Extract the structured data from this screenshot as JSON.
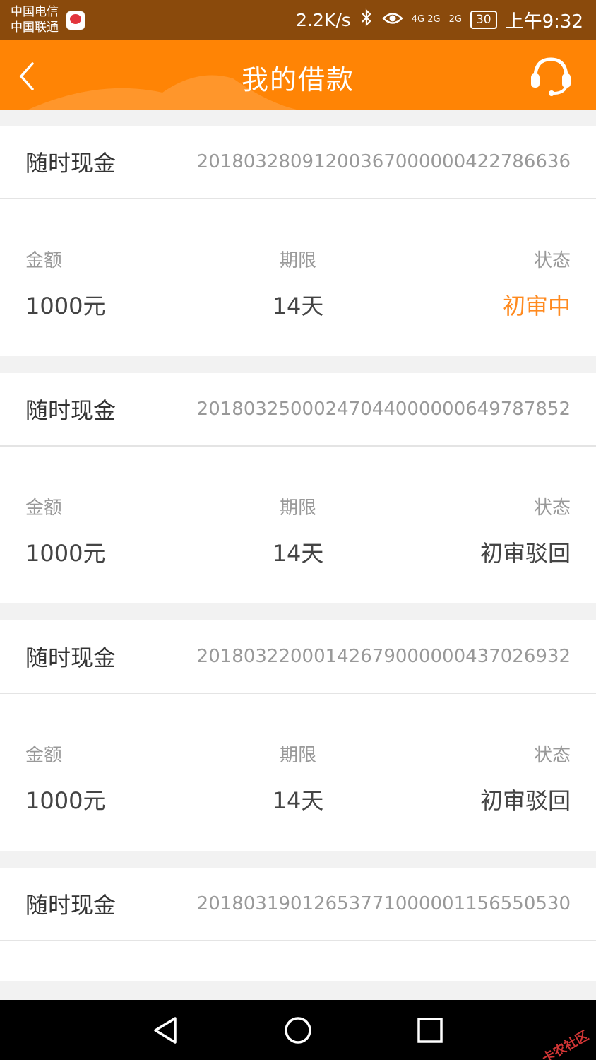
{
  "status_bar": {
    "carrier_1": "中国电信",
    "carrier_2": "中国联通",
    "net_speed": "2.2K/s",
    "signal_1": "4G 2G",
    "signal_2": "2G",
    "battery": "30",
    "time": "上午9:32"
  },
  "header": {
    "title": "我的借款",
    "back_icon": "chevron-left-icon",
    "service_icon": "headset-icon",
    "bar_color": "#ff8405"
  },
  "labels": {
    "amount": "金额",
    "term": "期限",
    "status": "状态"
  },
  "loans": [
    {
      "product": "随时现金",
      "order_no": "20180328091200367000000422786636",
      "amount": "1000元",
      "term": "14天",
      "status": "初审中",
      "status_color": "#ff8a1f"
    },
    {
      "product": "随时现金",
      "order_no": "20180325000247044000000649787852",
      "amount": "1000元",
      "term": "14天",
      "status": "初审驳回",
      "status_color": "#444444"
    },
    {
      "product": "随时现金",
      "order_no": "20180322000142679000000437026932",
      "amount": "1000元",
      "term": "14天",
      "status": "初审驳回",
      "status_color": "#444444"
    },
    {
      "product": "随时现金",
      "order_no": "20180319012653771000001156550530"
    }
  ],
  "nav_bar": {
    "back_icon": "triangle-back-icon",
    "home_icon": "circle-home-icon",
    "recent_icon": "square-recent-icon"
  },
  "watermark": "卡农社区"
}
